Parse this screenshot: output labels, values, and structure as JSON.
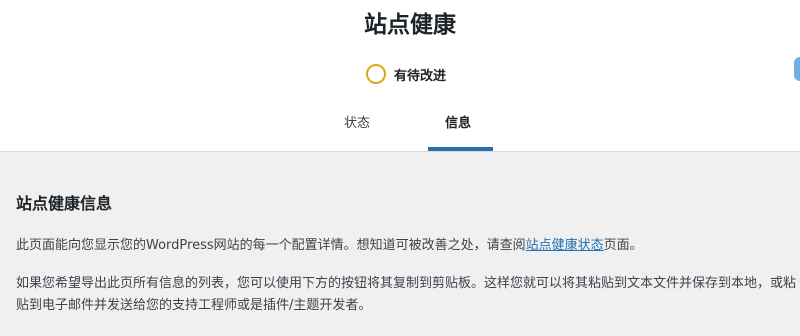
{
  "header": {
    "title": "站点健康",
    "status_label": "有待改进",
    "status_color": "#dba617"
  },
  "tabs": [
    {
      "label": "状态",
      "active": false
    },
    {
      "label": "信息",
      "active": true
    }
  ],
  "accent_color": "#2271b1",
  "content": {
    "section_title": "站点健康信息",
    "paragraph1": {
      "before": "此页面能向您显示您的WordPress网站的每一个配置详情。想知道可被改善之处，请查阅",
      "link": "站点健康状态",
      "after": "页面。"
    },
    "paragraph2": "如果您希望导出此页所有信息的列表，您可以使用下方的按钮将其复制到剪贴板。这样您就可以将其粘贴到文本文件并保存到本地，或粘贴到电子邮件并发送给您的支持工程师或是插件/主题开发者。"
  }
}
